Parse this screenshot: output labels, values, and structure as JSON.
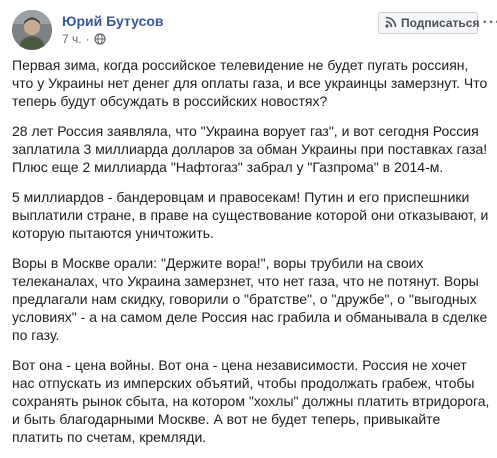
{
  "post": {
    "author": "Юрий Бутусов",
    "time": "7 ч.",
    "separator": "·",
    "privacy_icon": "globe-icon",
    "subscribe_label": "Подписаться",
    "subscribe_icon": "rss-icon",
    "more_icon": "more-options-icon",
    "more_glyph": "···",
    "paragraphs": [
      "Первая зима, когда российское телевидение не будет пугать россиян, что у Украины нет денег для оплаты газа, и все украинцы замерзнут. Что теперь будут обсуждать в российских новостях?",
      "28 лет Россия заявляла, что \"Украина ворует газ\", и вот сегодня Россия заплатила 3 миллиарда долларов за обман Украины при поставках газа! Плюс еще 2 миллиарда \"Нафтогаз\" забрал у \"Газпрома\" в 2014-м.",
      "5 миллиардов - бандеровцам и правосекам! Путин и его приспешники выплатили стране, в праве на существование которой они отказывают, и которую пытаются уничтожить.",
      "Воры в Москве орали: \"Держите вора!\", воры трубили на своих телеканалах, что Украина замерзнет, что нет газа, что не потянут. Воры предлагали нам скидку, говорили о \"братстве\", о \"дружбе\", о \"выгодных условиях\" - а на самом деле Россия нас грабила и обманывала в сделке по газу.",
      "Вот она - цена войны. Вот она - цена независимости. Россия не хочет нас отпускать из имперских объятий, чтобы продолжать грабеж, чтобы сохранять рынок сбыта, на котором \"хохлы\" должны платить втридорога, и быть благодарными Москве. А вот не будет теперь, привыкайте платить по счетам, кремляди."
    ]
  },
  "colors": {
    "author_link": "#385898",
    "meta_text": "#616770",
    "body_text": "#1c1e21",
    "button_bg": "#f5f6f7",
    "button_border": "#ccd0d5"
  }
}
